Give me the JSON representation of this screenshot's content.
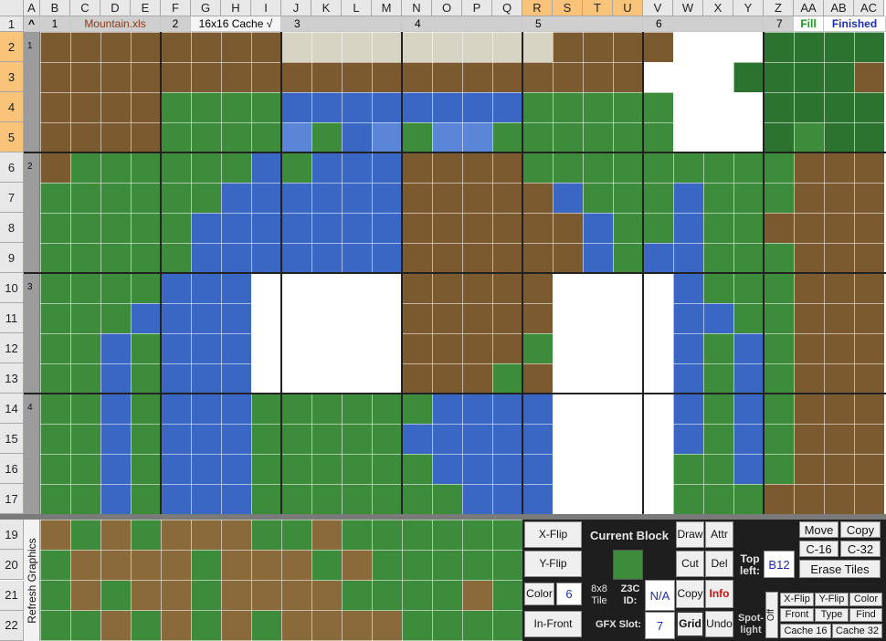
{
  "columns": [
    "A",
    "B",
    "C",
    "D",
    "E",
    "F",
    "G",
    "H",
    "I",
    "J",
    "K",
    "L",
    "M",
    "N",
    "O",
    "P",
    "Q",
    "R",
    "S",
    "T",
    "U",
    "V",
    "W",
    "X",
    "Y",
    "Z",
    "AA",
    "AB",
    "AC"
  ],
  "selected_columns": [
    "R",
    "S",
    "T",
    "U"
  ],
  "rows": [
    "1",
    "2",
    "3",
    "4",
    "5",
    "6",
    "7",
    "8",
    "9",
    "10",
    "11",
    "12",
    "13",
    "14",
    "15",
    "16",
    "17",
    "19",
    "20",
    "21",
    "22"
  ],
  "row1": {
    "corner_mark": "^",
    "screen1": "1",
    "file_name": "Mountain.xls",
    "screen2": "2",
    "cache_label": "16x16 Cache √",
    "screen3": "3",
    "screen4": "4",
    "screen5": "5",
    "screen6": "6",
    "screen7": "7",
    "fill_label": "Fill",
    "finished_label": "Finished"
  },
  "block_rows": [
    "1",
    "2",
    "3",
    "4"
  ],
  "refresh_label": "Refresh Graphics",
  "panel": {
    "xflip": "X-Flip",
    "yflip": "Y-Flip",
    "color_label": "Color",
    "color_value": "6",
    "infront": "In-Front",
    "current_block": "Current Block",
    "tile_size": "8x8 Tile",
    "z3c_id_label": "Z3C ID:",
    "z3c_id_value": "N/A",
    "gfx_slot_label": "GFX Slot:",
    "gfx_slot_value": "7",
    "draw": "Draw",
    "attr": "Attr",
    "cut": "Cut",
    "del": "Del",
    "copy": "Copy",
    "info": "Info",
    "grid": "Grid",
    "undo": "Undo",
    "top_left_label": "Top left:",
    "top_left_value": "B12",
    "move": "Move",
    "copy2": "Copy",
    "c16": "C-16",
    "c32": "C-32",
    "erase_tiles": "Erase Tiles",
    "spotlight_label": "Spot-light",
    "off_label": "Off",
    "xflip2": "X-Flip",
    "yflip2": "Y-Flip",
    "color2": "Color",
    "front": "Front",
    "type": "Type",
    "find": "Find",
    "cache16": "Cache 16",
    "cache32": "Cache 32"
  },
  "colors": {
    "grass": "#3c8c3c",
    "grass_dark": "#2d7330",
    "water": "#3b67c4",
    "water_light": "#5b86d8",
    "dirt": "#7a5a2e",
    "rock": "#d8d4c4",
    "highlight_header": "#f9c37a",
    "fill_text": "#1a9a1a",
    "finished_text": "#1a2fb0",
    "info_text": "#d01010"
  }
}
